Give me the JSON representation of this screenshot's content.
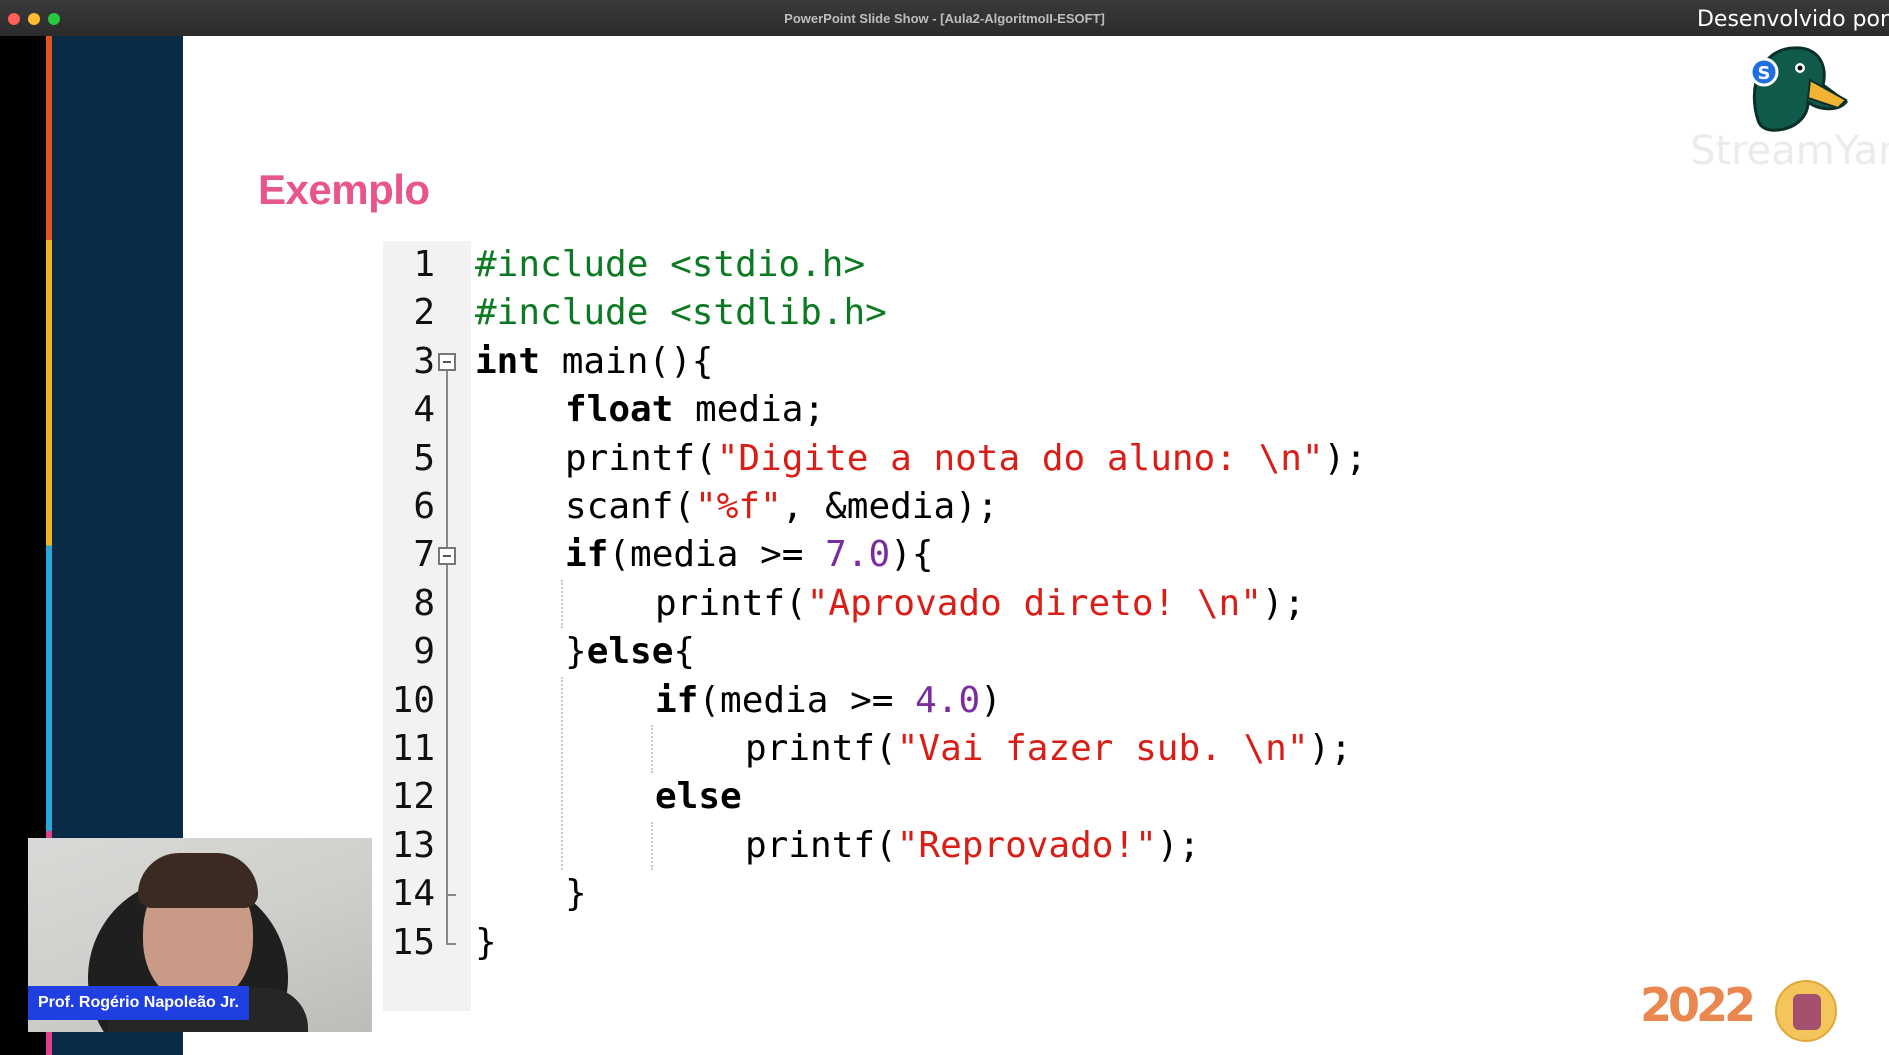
{
  "window": {
    "title": "PowerPoint Slide Show - [Aula2-AlgoritmoII-ESOFT]",
    "overlay_label": "Desenvolvido por"
  },
  "slide": {
    "title": "Exemplo",
    "code_lines": [
      {
        "n": "1",
        "indent": 0,
        "tokens": [
          {
            "t": "#include <stdio.h>",
            "c": "pp"
          }
        ]
      },
      {
        "n": "2",
        "indent": 0,
        "tokens": [
          {
            "t": "#include <stdlib.h>",
            "c": "pp"
          }
        ]
      },
      {
        "n": "3",
        "indent": 0,
        "tokens": [
          {
            "t": "int",
            "c": "kw"
          },
          {
            "t": " main(){",
            "c": ""
          }
        ]
      },
      {
        "n": "4",
        "indent": 1,
        "tokens": [
          {
            "t": "float",
            "c": "kw"
          },
          {
            "t": " media;",
            "c": ""
          }
        ]
      },
      {
        "n": "5",
        "indent": 1,
        "tokens": [
          {
            "t": "printf(",
            "c": ""
          },
          {
            "t": "\"Digite a nota do aluno: \\n\"",
            "c": "str"
          },
          {
            "t": ");",
            "c": ""
          }
        ]
      },
      {
        "n": "6",
        "indent": 1,
        "tokens": [
          {
            "t": "scanf(",
            "c": ""
          },
          {
            "t": "\"%f\"",
            "c": "str"
          },
          {
            "t": ", &media);",
            "c": ""
          }
        ]
      },
      {
        "n": "7",
        "indent": 1,
        "tokens": [
          {
            "t": "if",
            "c": "kw"
          },
          {
            "t": "(media >= ",
            "c": ""
          },
          {
            "t": "7.0",
            "c": "num"
          },
          {
            "t": "){",
            "c": ""
          }
        ]
      },
      {
        "n": "8",
        "indent": 2,
        "tokens": [
          {
            "t": "printf(",
            "c": ""
          },
          {
            "t": "\"Aprovado direto! \\n\"",
            "c": "str"
          },
          {
            "t": ");",
            "c": ""
          }
        ]
      },
      {
        "n": "9",
        "indent": 1,
        "tokens": [
          {
            "t": "}",
            "c": ""
          },
          {
            "t": "else",
            "c": "kw"
          },
          {
            "t": "{",
            "c": ""
          }
        ]
      },
      {
        "n": "10",
        "indent": 2,
        "tokens": [
          {
            "t": "if",
            "c": "kw"
          },
          {
            "t": "(media >= ",
            "c": ""
          },
          {
            "t": "4.0",
            "c": "num"
          },
          {
            "t": ")",
            "c": ""
          }
        ]
      },
      {
        "n": "11",
        "indent": 3,
        "tokens": [
          {
            "t": "printf(",
            "c": ""
          },
          {
            "t": "\"Vai fazer sub. \\n\"",
            "c": "str"
          },
          {
            "t": ");",
            "c": ""
          }
        ]
      },
      {
        "n": "12",
        "indent": 2,
        "tokens": [
          {
            "t": "else",
            "c": "kw"
          }
        ]
      },
      {
        "n": "13",
        "indent": 3,
        "tokens": [
          {
            "t": "printf(",
            "c": ""
          },
          {
            "t": "\"Reprovado!\"",
            "c": "str"
          },
          {
            "t": ");",
            "c": ""
          }
        ]
      },
      {
        "n": "14",
        "indent": 1,
        "tokens": [
          {
            "t": "}",
            "c": ""
          }
        ]
      },
      {
        "n": "15",
        "indent": 0,
        "tokens": [
          {
            "t": "}",
            "c": ""
          }
        ]
      }
    ]
  },
  "webcam": {
    "presenter_name": "Prof. Rogério Napoleão Jr."
  },
  "branding": {
    "streamyard_text": "StreamYard",
    "event_logo_text": "2022",
    "colors": {
      "title_pink": "#e8548c",
      "preprocessor_green": "#0b7a22",
      "string_red": "#d91e18",
      "number_purple": "#7a2c9e",
      "name_tag_blue": "#1f3fe0"
    }
  }
}
